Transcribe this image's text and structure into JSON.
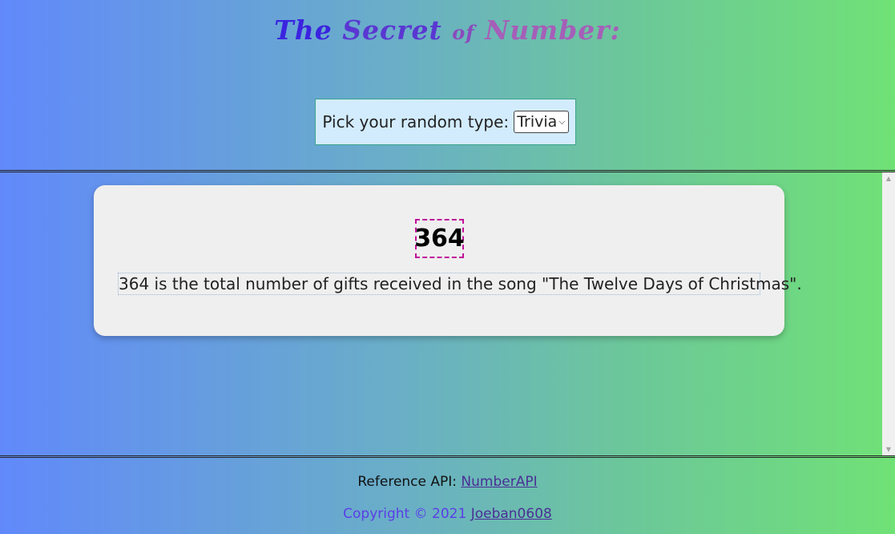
{
  "header": {
    "title_words": [
      "The",
      "Secret",
      "of",
      "Number:"
    ],
    "title_colors": [
      "#3b23e0",
      "#5a37d2",
      "#8a4bbd",
      "#a55fb8"
    ]
  },
  "picker": {
    "label": "Pick your random type:",
    "selected": "Trivia"
  },
  "result": {
    "number": "364",
    "fact": "364 is the total number of gifts received in the song \"The Twelve Days of Christmas\"."
  },
  "footer": {
    "reference_label": "Reference API:",
    "reference_link": "NumberAPI",
    "copyright": "Copyright © 2021",
    "author_link": "Joeban0608",
    "copyright_color": "#5b3ee6",
    "link_color": "#4a2f95"
  }
}
